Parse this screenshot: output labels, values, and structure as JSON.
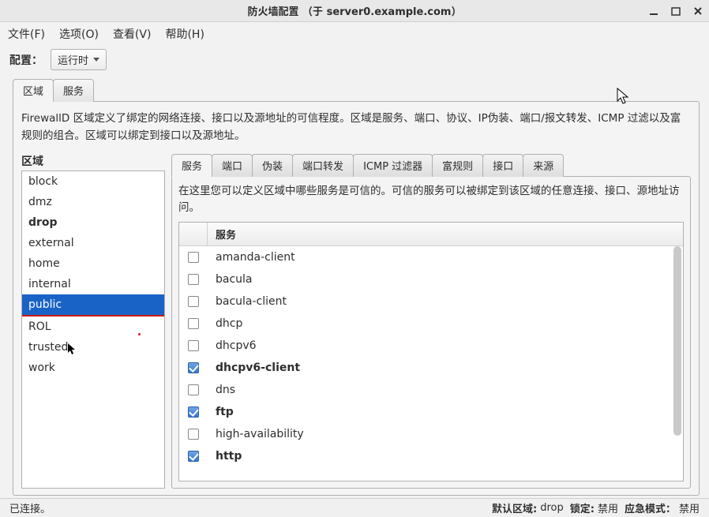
{
  "window": {
    "title": "防火墙配置 （于  server0.example.com）"
  },
  "menubar": {
    "file": "文件(F)",
    "options": "选项(O)",
    "view": "查看(V)",
    "help": "帮助(H)"
  },
  "config": {
    "label": "配置：",
    "value": "运行时"
  },
  "outer_tabs": {
    "zone": "区域",
    "service": "服务"
  },
  "zone_desc": "FirewallD 区域定义了绑定的网络连接、接口以及源地址的可信程度。区域是服务、端口、协议、IP伪装、端口/报文转发、ICMP 过滤以及富规则的组合。区域可以绑定到接口以及源地址。",
  "zone_label": "区域",
  "zones": [
    {
      "name": "block",
      "bold": false,
      "selected": false
    },
    {
      "name": "dmz",
      "bold": false,
      "selected": false
    },
    {
      "name": "drop",
      "bold": true,
      "selected": false
    },
    {
      "name": "external",
      "bold": false,
      "selected": false
    },
    {
      "name": "home",
      "bold": false,
      "selected": false
    },
    {
      "name": "internal",
      "bold": false,
      "selected": false
    },
    {
      "name": "public",
      "bold": false,
      "selected": true
    },
    {
      "name": "ROL",
      "bold": false,
      "selected": false
    },
    {
      "name": "trusted",
      "bold": false,
      "selected": false
    },
    {
      "name": "work",
      "bold": false,
      "selected": false
    }
  ],
  "inner_tabs": {
    "services": "服务",
    "ports": "端口",
    "masquerade": "伪装",
    "port_forward": "端口转发",
    "icmp_filter": "ICMP 过滤器",
    "rich_rules": "富规则",
    "interfaces": "接口",
    "sources": "来源"
  },
  "services_desc": "在这里您可以定义区域中哪些服务是可信的。可信的服务可以被绑定到该区域的任意连接、接口、源地址访问。",
  "services_header": "服务",
  "services": [
    {
      "name": "amanda-client",
      "checked": false,
      "bold": false
    },
    {
      "name": "bacula",
      "checked": false,
      "bold": false
    },
    {
      "name": "bacula-client",
      "checked": false,
      "bold": false
    },
    {
      "name": "dhcp",
      "checked": false,
      "bold": false
    },
    {
      "name": "dhcpv6",
      "checked": false,
      "bold": false
    },
    {
      "name": "dhcpv6-client",
      "checked": true,
      "bold": true
    },
    {
      "name": "dns",
      "checked": false,
      "bold": false
    },
    {
      "name": "ftp",
      "checked": true,
      "bold": true
    },
    {
      "name": "high-availability",
      "checked": false,
      "bold": false
    },
    {
      "name": "http",
      "checked": true,
      "bold": true
    }
  ],
  "status": {
    "connected": "已连接。",
    "default_zone_label": "默认区域:",
    "default_zone": "drop",
    "lockdown_label": "锁定:",
    "lockdown": "禁用",
    "panic_label": "应急模式：",
    "panic": "禁用"
  }
}
